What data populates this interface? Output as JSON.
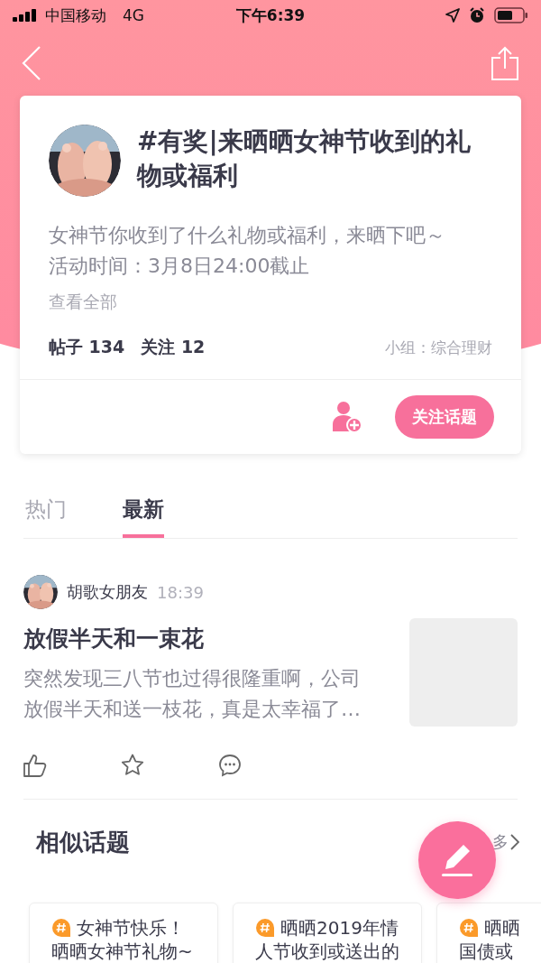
{
  "status_bar": {
    "carrier": "中国移动",
    "network": "4G",
    "time": "下午6:39"
  },
  "topic": {
    "title": "#有奖|来晒晒女神节收到的礼物或福利",
    "description_lines": [
      "女神节你收到了什么礼物或福利，来晒下吧～",
      "活动时间：3月8日24:00截止"
    ],
    "view_all": "查看全部",
    "posts_label": "帖子 134",
    "followers_label": "关注 12",
    "group": "小组：综合理财",
    "follow_button": "关注话题"
  },
  "tabs": [
    {
      "label": "热门",
      "selected": false
    },
    {
      "label": "最新",
      "selected": true
    }
  ],
  "post": {
    "author": "胡歌女朋友",
    "time": "18:39",
    "title": "放假半天和一束花",
    "excerpt": "突然发现三八节也过得很隆重啊，公司放假半天和送一枝花，真是太幸福了…"
  },
  "similar": {
    "title": "相似话题",
    "more": "多",
    "cards": [
      {
        "title_lines": [
          "女神节快乐！",
          "晒晒女神节礼物~"
        ]
      },
      {
        "title_lines": [
          "晒晒2019年情",
          "人节收到或送出的"
        ]
      },
      {
        "title_lines": [
          "晒晒",
          "国债或"
        ]
      }
    ]
  }
}
